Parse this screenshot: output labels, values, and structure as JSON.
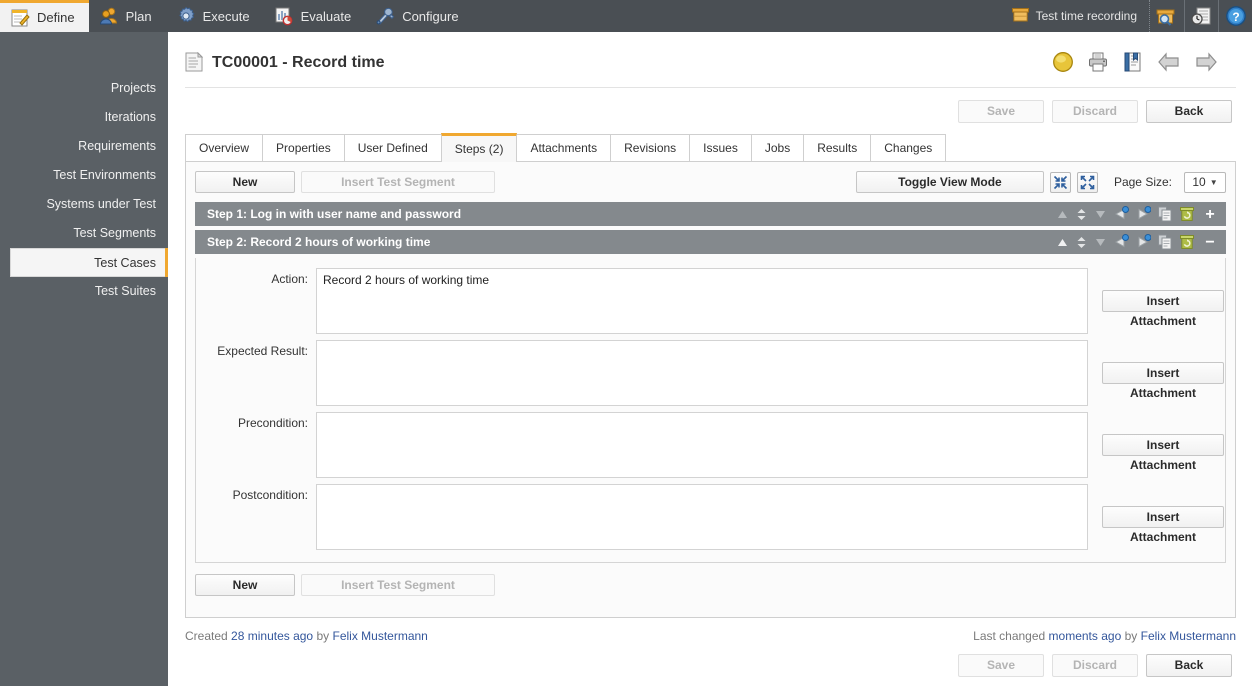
{
  "topnav": {
    "items": [
      {
        "label": "Define",
        "icon": "notepad-pencil-icon",
        "active": true
      },
      {
        "label": "Plan",
        "icon": "users-icon",
        "active": false
      },
      {
        "label": "Execute",
        "icon": "gear-icon",
        "active": false
      },
      {
        "label": "Evaluate",
        "icon": "chart-report-icon",
        "active": false
      },
      {
        "label": "Configure",
        "icon": "tools-icon",
        "active": false
      }
    ],
    "time_recording_label": "Test time recording",
    "time_recording_icon": "box-icon",
    "right_icons": [
      {
        "name": "search-box-icon"
      },
      {
        "name": "document-clock-icon"
      },
      {
        "name": "help-icon"
      }
    ]
  },
  "sidebar": {
    "items": [
      {
        "label": "Projects",
        "active": false
      },
      {
        "label": "Iterations",
        "active": false
      },
      {
        "label": "Requirements",
        "active": false
      },
      {
        "label": "Test Environments",
        "active": false
      },
      {
        "label": "Systems under Test",
        "active": false
      },
      {
        "label": "Test Segments",
        "active": false
      },
      {
        "label": "Test Cases",
        "active": true
      },
      {
        "label": "Test Suites",
        "active": false
      }
    ]
  },
  "page": {
    "title": "TC00001 - Record time",
    "title_icon": "document-icon",
    "head_icons": [
      {
        "name": "status-yellow-icon"
      },
      {
        "name": "print-icon"
      },
      {
        "name": "report-icon"
      },
      {
        "name": "previous-arrow-icon"
      },
      {
        "name": "next-arrow-icon"
      }
    ]
  },
  "actions": {
    "save_label": "Save",
    "discard_label": "Discard",
    "back_label": "Back",
    "save_enabled": false,
    "discard_enabled": false,
    "back_enabled": true
  },
  "tabs": [
    {
      "label": "Overview",
      "active": false
    },
    {
      "label": "Properties",
      "active": false
    },
    {
      "label": "User Defined",
      "active": false
    },
    {
      "label": "Steps (2)",
      "active": true
    },
    {
      "label": "Attachments",
      "active": false
    },
    {
      "label": "Revisions",
      "active": false
    },
    {
      "label": "Issues",
      "active": false
    },
    {
      "label": "Jobs",
      "active": false
    },
    {
      "label": "Results",
      "active": false
    },
    {
      "label": "Changes",
      "active": false
    }
  ],
  "toolbar": {
    "new_label": "New",
    "insert_segment_label": "Insert Test Segment",
    "insert_segment_enabled": false,
    "toggle_view_label": "Toggle View Mode",
    "collapse_all_icon": "collapse-all-icon",
    "expand_all_icon": "expand-all-icon",
    "page_size_label": "Page Size:",
    "page_size_value": "10"
  },
  "steps": [
    {
      "title": "Step 1: Log in with user name and password",
      "expanded": false,
      "toggle_symbol": "+"
    },
    {
      "title": "Step 2: Record 2 hours of working time",
      "expanded": true,
      "toggle_symbol": "−",
      "fields": [
        {
          "label": "Action:",
          "value": "Record 2 hours of working time",
          "attach_label": "Insert Attachment"
        },
        {
          "label": "Expected Result:",
          "value": "",
          "attach_label": "Insert Attachment"
        },
        {
          "label": "Precondition:",
          "value": "",
          "attach_label": "Insert Attachment"
        },
        {
          "label": "Postcondition:",
          "value": "",
          "attach_label": "Insert Attachment"
        }
      ]
    }
  ],
  "step_controls": [
    {
      "name": "move-to-top-icon"
    },
    {
      "name": "move-updown-icon"
    },
    {
      "name": "move-to-bottom-icon"
    },
    {
      "name": "outdent-icon"
    },
    {
      "name": "indent-icon"
    },
    {
      "name": "copy-icon"
    },
    {
      "name": "delete-icon"
    }
  ],
  "footer": {
    "created_prefix": "Created",
    "created_time": "28 minutes ago",
    "created_by_word": "by",
    "created_user": "Felix Mustermann",
    "changed_prefix": "Last changed",
    "changed_time": "moments ago",
    "changed_by_word": "by",
    "changed_user": "Felix Mustermann"
  },
  "colors": {
    "accent": "#f0a830",
    "topbar": "#4a4f54",
    "sidebar": "#5a6065",
    "step_header": "#84898d",
    "link": "#33569b"
  }
}
